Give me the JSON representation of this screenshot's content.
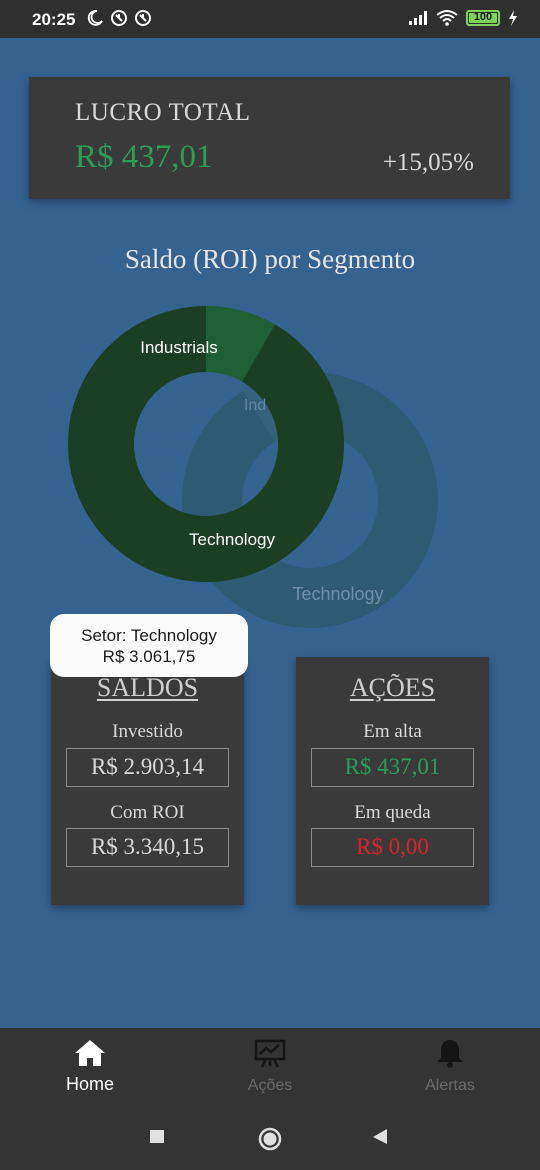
{
  "status_bar": {
    "time": "20:25",
    "battery": "100",
    "icons": [
      "moon-icon",
      "data-saver-icon",
      "data-saver-icon",
      "signal-icon",
      "wifi-icon",
      "battery-icon",
      "charging-icon"
    ]
  },
  "summary": {
    "label": "LUCRO TOTAL",
    "value": "R$ 437,01",
    "percent": "+15,05%"
  },
  "chart": {
    "title": "Saldo (ROI) por Segmento"
  },
  "chart_data": {
    "type": "pie",
    "title": "Saldo (ROI) por Segmento",
    "categories": [
      "Industrials",
      "Technology"
    ],
    "values": [
      278.4,
      3061.75
    ],
    "colors": [
      "#1f5f33",
      "#1a3f22"
    ],
    "ghost_colors": [
      "#35617c",
      "#2f5a73"
    ],
    "tooltip": {
      "line1": "Setor: Technology",
      "line2": "R$ 3.061,75"
    },
    "ghost_labels": [
      "Ind",
      "Technology"
    ]
  },
  "saldos": {
    "title": "SALDOS",
    "invested_label": "Investido",
    "invested_value": "R$ 2.903,14",
    "roi_label": "Com ROI",
    "roi_value": "R$ 3.340,15"
  },
  "acoes": {
    "title": "AÇÕES",
    "up_label": "Em alta",
    "up_value": "R$ 437,01",
    "down_label": "Em queda",
    "down_value": "R$ 0,00"
  },
  "nav": {
    "items": [
      {
        "label": "Home",
        "icon": "home-icon",
        "active": true
      },
      {
        "label": "Ações",
        "icon": "chart-board-icon",
        "active": false
      },
      {
        "label": "Alertas",
        "icon": "bell-icon",
        "active": false
      }
    ]
  },
  "system_nav": [
    "recents-square-icon",
    "home-circle-icon",
    "back-triangle-icon"
  ]
}
